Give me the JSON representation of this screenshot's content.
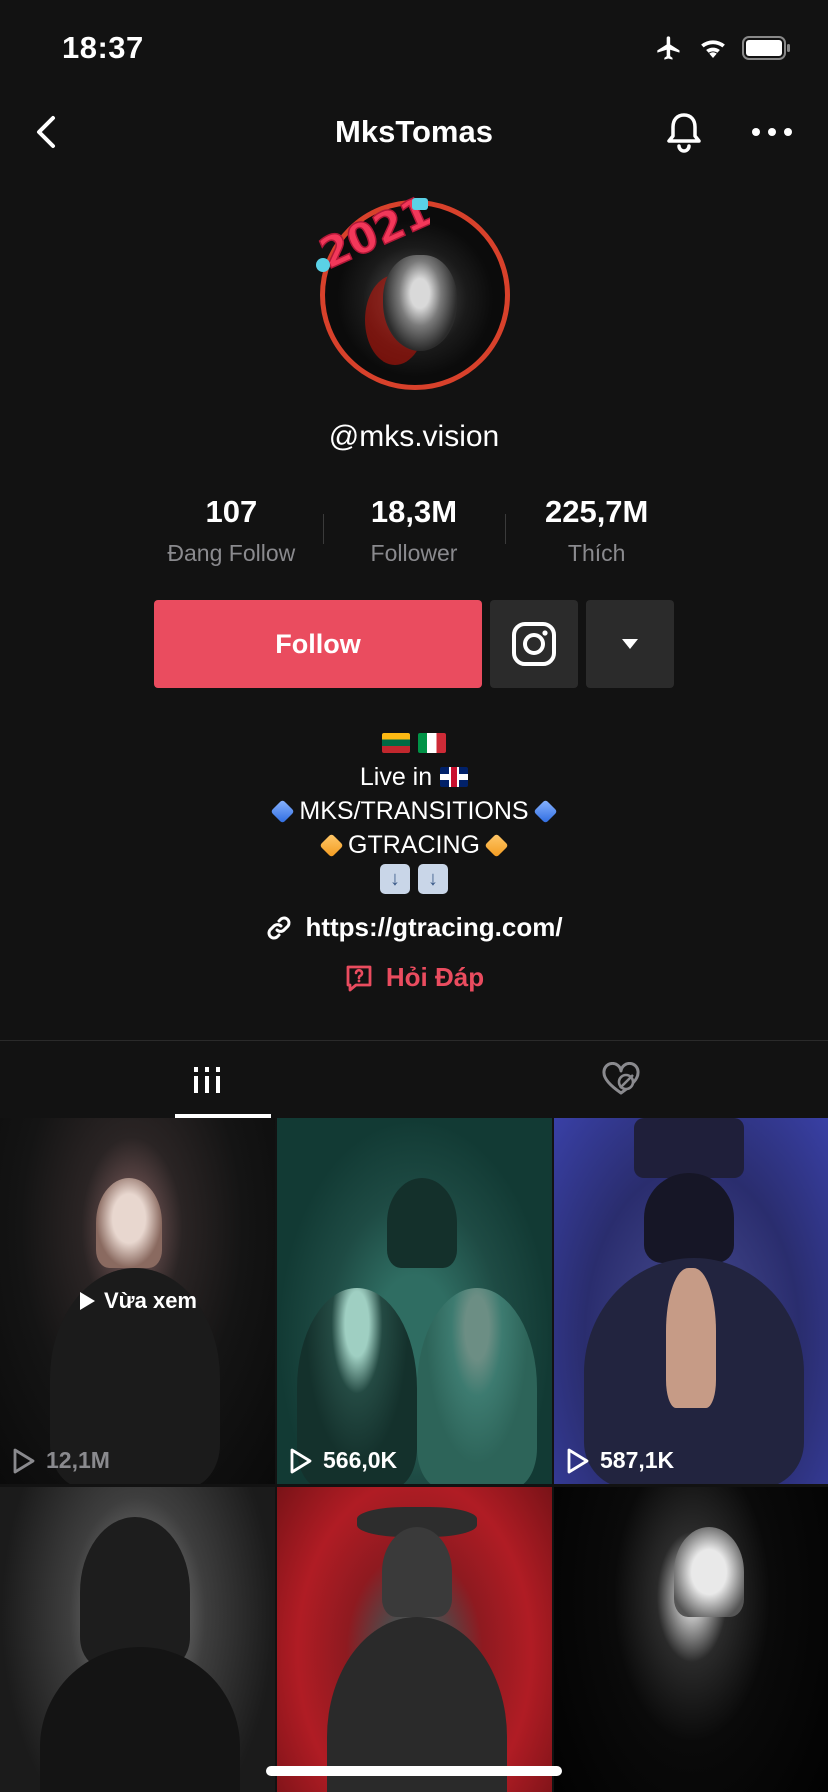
{
  "status_bar": {
    "time": "18:37"
  },
  "nav": {
    "title": "MksTomas"
  },
  "profile": {
    "handle": "@mks.vision",
    "stats": [
      {
        "value": "107",
        "label": "Đang Follow"
      },
      {
        "value": "18,3M",
        "label": "Follower"
      },
      {
        "value": "225,7M",
        "label": "Thích"
      }
    ]
  },
  "actions": {
    "follow_label": "Follow"
  },
  "bio": {
    "line2": "Live in",
    "line3": "MKS/TRANSITIONS",
    "line4": "GTRACING"
  },
  "link": {
    "url": "https://gtracing.com/"
  },
  "qa": {
    "label": "Hỏi Đáp"
  },
  "videos": [
    {
      "views": "12,1M",
      "watched_label": "Vừa xem"
    },
    {
      "views": "566,0K"
    },
    {
      "views": "587,1K"
    },
    {
      "views": ""
    },
    {
      "views": ""
    },
    {
      "views": ""
    }
  ],
  "colors": {
    "accent": "#ea4c5f",
    "background": "#121212",
    "button_dark": "#2b2b2b",
    "secondary_text": "#8a8a8e"
  },
  "icons": [
    "back-icon",
    "bell-icon",
    "more-icon",
    "instagram-icon",
    "caret-down-icon",
    "link-icon",
    "qa-icon",
    "grid-icon",
    "liked-hidden-icon",
    "play-icon",
    "airplane-icon",
    "wifi-icon",
    "battery-icon"
  ]
}
